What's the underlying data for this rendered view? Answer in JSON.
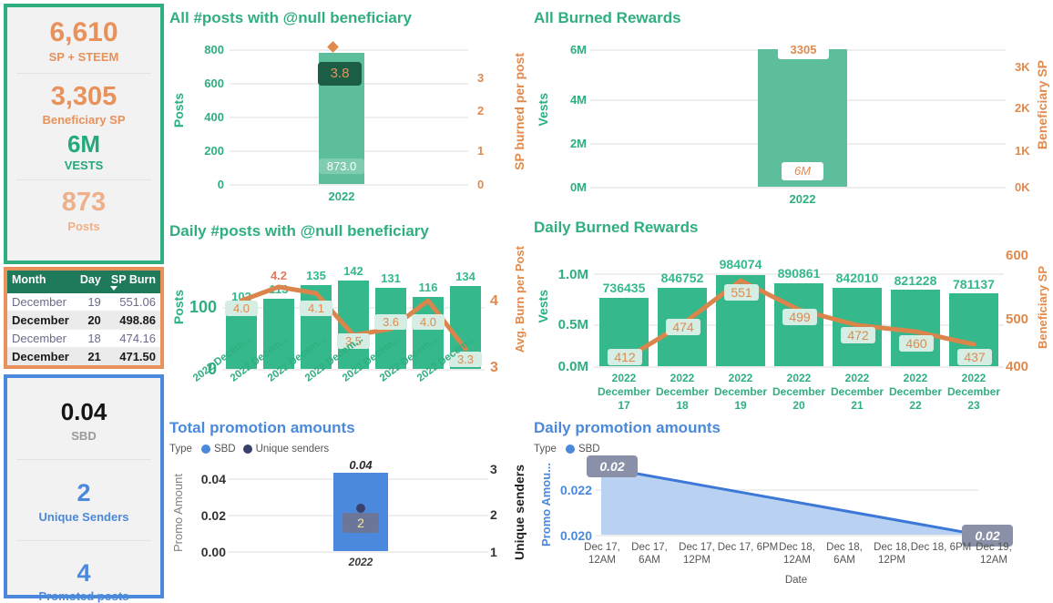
{
  "kpi_green": {
    "cards": [
      {
        "value": "6,610",
        "label": "SP + STEEM"
      },
      {
        "value": "3,305",
        "label": "Beneficiary SP"
      },
      {
        "value": "6M",
        "label": "VESTS"
      },
      {
        "value": "873",
        "label": "Posts"
      }
    ],
    "border_color": "#2FAF7F"
  },
  "burn_table": {
    "columns": [
      "Month",
      "Day",
      "SP Burn"
    ],
    "sort_column": "SP Burn",
    "sort_direction": "descending",
    "rows": [
      {
        "month": "December",
        "day": "19",
        "sp_burn": "551.06"
      },
      {
        "month": "December",
        "day": "20",
        "sp_burn": "498.86"
      },
      {
        "month": "December",
        "day": "18",
        "sp_burn": "474.16"
      },
      {
        "month": "December",
        "day": "21",
        "sp_burn": "471.50"
      }
    ],
    "border_color": "#E8915B"
  },
  "kpi_blue": {
    "cards": [
      {
        "value": "0.04",
        "label": "SBD"
      },
      {
        "value": "2",
        "label": "Unique Senders"
      },
      {
        "value": "4",
        "label": "Promoted posts"
      }
    ],
    "border_color": "#4A89DC"
  },
  "chart_data": [
    {
      "id": "all-posts-null-beneficiary",
      "type": "bar",
      "title": "All #posts with @null beneficiary",
      "categories": [
        "2022"
      ],
      "series": [
        {
          "name": "Posts",
          "values": [
            873.0
          ],
          "labels": [
            "873.0"
          ],
          "axis": "left",
          "color": "#5DBE9B"
        },
        {
          "name": "SP burned per post",
          "values": [
            3.8
          ],
          "labels": [
            "3.8"
          ],
          "axis": "right",
          "color": "#E08A4E",
          "marker": "diamond"
        }
      ],
      "ylabel": "Posts",
      "y2label": "SP burned per post",
      "yticks": [
        "0",
        "200",
        "400",
        "600",
        "800"
      ],
      "y2ticks": [
        "0",
        "1",
        "2",
        "3"
      ],
      "ylim": [
        0,
        900
      ],
      "y2lim": [
        0,
        4
      ],
      "xlabel": "",
      "grid": true
    },
    {
      "id": "all-burned-rewards",
      "type": "bar",
      "title": "All Burned Rewards",
      "categories": [
        "2022"
      ],
      "series": [
        {
          "name": "Vests",
          "values": [
            6000000
          ],
          "labels": [
            "6M"
          ],
          "axis": "left",
          "color": "#5DBE9B"
        },
        {
          "name": "Beneficiary SP",
          "values": [
            3305
          ],
          "labels": [
            "3305"
          ],
          "axis": "right",
          "color": "#E08A4E"
        }
      ],
      "ylabel": "Vests",
      "y2label": "Beneficiary SP",
      "yticks": [
        "0M",
        "2M",
        "4M",
        "6M"
      ],
      "y2ticks": [
        "0K",
        "1K",
        "2K",
        "3K"
      ],
      "ylim": [
        0,
        6000000
      ],
      "y2lim": [
        0,
        3500
      ],
      "grid": true
    },
    {
      "id": "daily-posts-null-beneficiary",
      "type": "bar",
      "title": "Daily #posts with @null beneficiary",
      "categories": [
        "2022 Decem...",
        "2022 Decem...",
        "2022 Decem...",
        "2022 Decem...",
        "2022 Decem...",
        "2022 Decem...",
        "2022 Decem..."
      ],
      "series": [
        {
          "name": "Posts",
          "values": [
            102,
            113,
            135,
            142,
            131,
            116,
            134
          ],
          "labels": [
            "102",
            "113",
            "135",
            "142",
            "131",
            "116",
            "134"
          ],
          "axis": "left",
          "color": "#35B98C"
        },
        {
          "name": "Avg. Burn per Post",
          "values": [
            4.0,
            4.2,
            4.1,
            3.5,
            3.6,
            4.0,
            3.3
          ],
          "labels": [
            "4.0",
            "4.2",
            "4.1",
            "3.5",
            "3.6",
            "4.0",
            "3.3"
          ],
          "axis": "right",
          "color": "#D9854C"
        }
      ],
      "ylabel": "Posts",
      "y2label": "Avg. Burn per Post",
      "yticks": [
        "0",
        "100"
      ],
      "y2ticks": [
        "3",
        "4"
      ],
      "ylim": [
        0,
        160
      ],
      "y2lim": [
        3,
        4.35
      ],
      "grid": true
    },
    {
      "id": "daily-burned-rewards",
      "type": "bar",
      "title": "Daily Burned Rewards",
      "categories": [
        "2022\nDecember\n17",
        "2022\nDecember\n18",
        "2022\nDecember\n19",
        "2022\nDecember\n20",
        "2022\nDecember\n21",
        "2022\nDecember\n22",
        "2022\nDecember\n23"
      ],
      "series": [
        {
          "name": "Vests",
          "values": [
            736435,
            846752,
            984074,
            890861,
            842010,
            821228,
            781137
          ],
          "labels": [
            "736435",
            "846752",
            "984074",
            "890861",
            "842010",
            "821228",
            "781137"
          ],
          "axis": "left",
          "color": "#35B98C"
        },
        {
          "name": "Beneficiary SP",
          "values": [
            412,
            474,
            551,
            499,
            472,
            460,
            437
          ],
          "labels": [
            "412",
            "474",
            "551",
            "499",
            "472",
            "460",
            "437"
          ],
          "axis": "right",
          "color": "#D9854C"
        }
      ],
      "ylabel": "Vests",
      "y2label": "Beneficiary SP",
      "yticks": [
        "0.0M",
        "0.5M",
        "1.0M"
      ],
      "y2ticks": [
        "400",
        "500",
        "600"
      ],
      "ylim": [
        0,
        1050000
      ],
      "y2lim": [
        400,
        600
      ],
      "grid": true
    },
    {
      "id": "total-promotion-amounts",
      "type": "bar",
      "title": "Total promotion amounts",
      "legend_title": "Type",
      "legend": [
        {
          "label": "SBD",
          "color": "#4A89DC"
        },
        {
          "label": "Unique senders",
          "color": "#39406B"
        }
      ],
      "categories": [
        "2022"
      ],
      "series": [
        {
          "name": "SBD",
          "values": [
            0.04
          ],
          "labels": [
            "0.04"
          ],
          "axis": "left",
          "color": "#4A89DC"
        },
        {
          "name": "Unique senders",
          "values": [
            2
          ],
          "labels": [
            "2"
          ],
          "axis": "right",
          "color": "#39406B"
        }
      ],
      "ylabel": "Promo Amount",
      "y2label": "Unique senders",
      "yticks": [
        "0.00",
        "0.02",
        "0.04"
      ],
      "y2ticks": [
        "1",
        "2",
        "3"
      ],
      "ylim": [
        0,
        0.047
      ],
      "y2lim": [
        1,
        3
      ],
      "grid": true
    },
    {
      "id": "daily-promotion-amounts",
      "type": "area",
      "title": "Daily promotion amounts",
      "legend_title": "Type",
      "legend": [
        {
          "label": "SBD",
          "color": "#4A89DC"
        }
      ],
      "x": [
        "Dec 17, 12AM",
        "Dec 17, 6AM",
        "Dec 17, 12PM",
        "Dec 17, 6PM",
        "Dec 18, 12AM",
        "Dec 18, 6AM",
        "Dec 18, 12PM",
        "Dec 18, 6PM",
        "Dec 19, 12AM"
      ],
      "series": [
        {
          "name": "SBD",
          "values": [
            0.023,
            null,
            null,
            null,
            null,
            null,
            null,
            null,
            0.02
          ],
          "point_labels": [
            "0.02",
            "0.02"
          ],
          "color": "#4A89DC"
        }
      ],
      "ylabel": "Promo Amou...",
      "xlabel": "Date",
      "yticks": [
        "0.020",
        "0.022"
      ],
      "ylim": [
        0.0197,
        0.0235
      ],
      "grid": true
    }
  ]
}
